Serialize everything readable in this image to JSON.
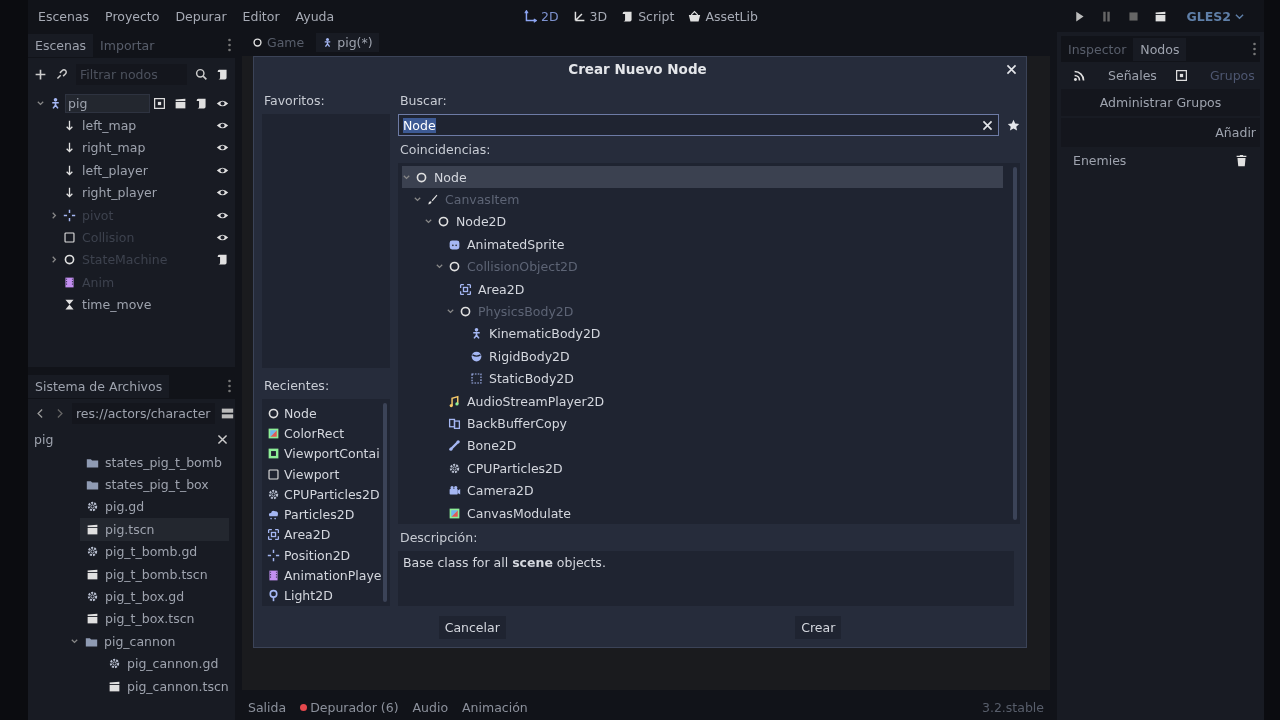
{
  "menu": [
    "Escenas",
    "Proyecto",
    "Depurar",
    "Editor",
    "Ayuda"
  ],
  "workspaces": [
    {
      "label": "2D",
      "kind": "axes",
      "selected": true
    },
    {
      "label": "3D",
      "kind": "axes3",
      "selected": false
    },
    {
      "label": "Script",
      "kind": "script",
      "selected": false
    },
    {
      "label": "AssetLib",
      "kind": "bag",
      "selected": false
    }
  ],
  "renderer": "GLES2",
  "scene_dock": {
    "tabs": [
      {
        "label": "Escenas",
        "selected": true
      },
      {
        "label": "Importar",
        "selected": false
      }
    ],
    "filter": {
      "placeholder": "Filtrar nodos"
    },
    "tree": [
      {
        "name": "pig",
        "kind": "figure",
        "selected": true,
        "expanded": true,
        "badges": [
          {
            "kind": "frame"
          },
          {
            "kind": "clapper"
          },
          {
            "kind": "script"
          },
          {
            "kind": "eye"
          }
        ],
        "children": [
          {
            "name": "left_map",
            "kind": "arrow",
            "badges": [
              {
                "kind": "eye"
              }
            ]
          },
          {
            "name": "right_map",
            "kind": "arrow",
            "badges": [
              {
                "kind": "eye"
              }
            ]
          },
          {
            "name": "left_player",
            "kind": "arrow",
            "badges": [
              {
                "kind": "eye"
              }
            ]
          },
          {
            "name": "right_player",
            "kind": "arrow",
            "badges": [
              {
                "kind": "eye"
              }
            ]
          },
          {
            "name": "pivot",
            "kind": "crosshair",
            "disabled": true,
            "expanded": false,
            "badges": [
              {
                "kind": "eye"
              }
            ]
          },
          {
            "name": "Collision",
            "kind": "square",
            "disabled": true,
            "badges": [
              {
                "kind": "eye"
              }
            ]
          },
          {
            "name": "StateMachine",
            "kind": "circle",
            "disabled": true,
            "expanded": false,
            "badges": [
              {
                "kind": "script"
              }
            ]
          },
          {
            "name": "Anim",
            "kind": "film",
            "disabled": true
          },
          {
            "name": "time_move",
            "kind": "hourglass"
          }
        ]
      }
    ]
  },
  "filesystem": {
    "title": "Sistema de Archivos",
    "path": "res://actors/character",
    "search": "pig",
    "files": [
      {
        "name": "states_pig_t_bomb",
        "kind": "folder"
      },
      {
        "name": "states_pig_t_box",
        "kind": "folder"
      },
      {
        "name": "pig.gd",
        "kind": "gear"
      },
      {
        "name": "pig.tscn",
        "kind": "clapper",
        "selected": true
      },
      {
        "name": "pig_t_bomb.gd",
        "kind": "gear"
      },
      {
        "name": "pig_t_bomb.tscn",
        "kind": "clapper"
      },
      {
        "name": "pig_t_box.gd",
        "kind": "gear"
      },
      {
        "name": "pig_t_box.tscn",
        "kind": "clapper"
      },
      {
        "name": "pig_cannon",
        "kind": "folder",
        "expanded": true,
        "children": [
          {
            "name": "pig_cannon.gd",
            "kind": "gear"
          },
          {
            "name": "pig_cannon.tscn",
            "kind": "clapper"
          }
        ]
      }
    ]
  },
  "center_tabs": [
    {
      "label": "Game",
      "kind": "circle",
      "selected": false
    },
    {
      "label": "pig(*)",
      "kind": "figure",
      "selected": true
    }
  ],
  "bottom_tabs": [
    {
      "label": "Salida",
      "alert": false
    },
    {
      "label": "Depurador (6)",
      "alert": true
    },
    {
      "label": "Audio",
      "alert": false
    },
    {
      "label": "Animación",
      "alert": false
    }
  ],
  "version": "3.2.stable",
  "right_dock": {
    "tabs": [
      {
        "label": "Inspector",
        "selected": false
      },
      {
        "label": "Nodos",
        "selected": true
      }
    ],
    "subtabs": [
      {
        "label": "Señales",
        "kind": "rss",
        "selected": false
      },
      {
        "label": "Grupos",
        "kind": "frame",
        "selected": true
      }
    ],
    "manage_label": "Administrar Grupos",
    "add_button": "Añadir",
    "groups": [
      "Enemies"
    ]
  },
  "dialog": {
    "title": "Crear Nuevo Node",
    "favorites_label": "Favoritos:",
    "recent_label": "Recientes:",
    "recent": [
      {
        "name": "Node",
        "kind": "circle"
      },
      {
        "name": "ColorRect",
        "kind": "gradient"
      },
      {
        "name": "ViewportContai",
        "kind": "vpc"
      },
      {
        "name": "Viewport",
        "kind": "square"
      },
      {
        "name": "CPUParticles2D",
        "kind": "gear"
      },
      {
        "name": "Particles2D",
        "kind": "cloud"
      },
      {
        "name": "Area2D",
        "kind": "area"
      },
      {
        "name": "Position2D",
        "kind": "crosshair"
      },
      {
        "name": "AnimationPlaye",
        "kind": "film"
      },
      {
        "name": "Light2D",
        "kind": "bulb"
      }
    ],
    "search_label": "Buscar:",
    "search": "Node",
    "matches_label": "Coincidencias:",
    "tree": [
      {
        "name": "Node",
        "kind": "circle",
        "selected": true,
        "expanded": true,
        "children": [
          {
            "name": "CanvasItem",
            "kind": "brush",
            "disabled": true,
            "expanded": true,
            "children": [
              {
                "name": "Node2D",
                "kind": "circle",
                "expanded": true,
                "children": [
                  {
                    "name": "AnimatedSprite",
                    "kind": "sprite"
                  },
                  {
                    "name": "CollisionObject2D",
                    "kind": "circle",
                    "disabled": true,
                    "expanded": true,
                    "children": [
                      {
                        "name": "Area2D",
                        "kind": "area"
                      },
                      {
                        "name": "PhysicsBody2D",
                        "kind": "circle",
                        "disabled": true,
                        "expanded": true,
                        "children": [
                          {
                            "name": "KinematicBody2D",
                            "kind": "figure"
                          },
                          {
                            "name": "RigidBody2D",
                            "kind": "globe"
                          },
                          {
                            "name": "StaticBody2D",
                            "kind": "dashed"
                          }
                        ]
                      }
                    ]
                  },
                  {
                    "name": "AudioStreamPlayer2D",
                    "kind": "note"
                  },
                  {
                    "name": "BackBufferCopy",
                    "kind": "copy"
                  },
                  {
                    "name": "Bone2D",
                    "kind": "bone"
                  },
                  {
                    "name": "CPUParticles2D",
                    "kind": "gear"
                  },
                  {
                    "name": "Camera2D",
                    "kind": "camera"
                  },
                  {
                    "name": "CanvasModulate",
                    "kind": "gradient"
                  }
                ]
              }
            ]
          }
        ]
      }
    ],
    "description_label": "Descripción:",
    "description": "Base class for all **scene** objects.",
    "buttons": [
      "Cancelar",
      "Crear"
    ]
  }
}
